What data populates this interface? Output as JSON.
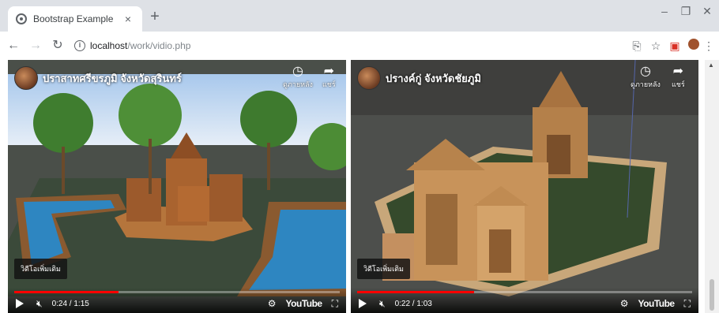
{
  "browser": {
    "tab_title": "Bootstrap Example",
    "tab_close": "×",
    "new_tab": "+",
    "url_host": "localhost",
    "url_path": "/work/vidio.php",
    "window_controls": {
      "minimize": "–",
      "restore": "❐",
      "close": "✕"
    },
    "icons": [
      "back-icon",
      "forward-icon",
      "reload-icon",
      "info-icon",
      "translate-icon",
      "star-icon",
      "extension-icon",
      "profile-icon",
      "menu-icon"
    ]
  },
  "videos": [
    {
      "title": "ปราสาทศรีขรภูมิ จังหวัดสุรินทร์",
      "watch_later": "ดูภายหลัง",
      "share": "แชร์",
      "more_videos": "วิดีโอเพิ่มเติม",
      "time": "0:24 / 1:15",
      "progress": 0.32,
      "youtube": "YouTube"
    },
    {
      "title": "ปรางค์กู่ จังหวัดชัยภูมิ",
      "watch_later": "ดูภายหลัง",
      "share": "แชร์",
      "more_videos": "วิดีโอเพิ่มเติม",
      "time": "0:22 / 1:03",
      "progress": 0.35,
      "youtube": "YouTube"
    }
  ],
  "colors": {
    "progress": "#ff0000",
    "tabstrip": "#dee1e6"
  }
}
